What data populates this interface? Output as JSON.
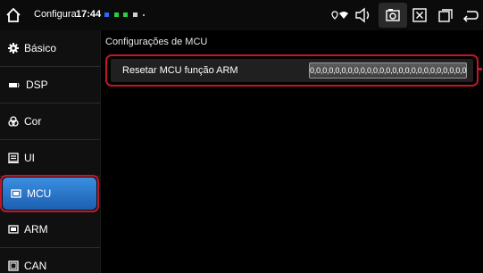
{
  "statusbar": {
    "app_title": "Configura",
    "time": "17:44",
    "notification_colors": [
      "#2a66ff",
      "#2ecc40",
      "#2ecc40",
      "#ffffff"
    ],
    "icons": [
      "home-icon",
      "location-icon",
      "wifi-icon",
      "volume-icon",
      "screenshot-icon",
      "close-window-icon",
      "recent-apps-icon",
      "back-icon"
    ]
  },
  "sidebar": {
    "items": [
      {
        "label": "Básico",
        "icon": "gear-icon"
      },
      {
        "label": "DSP",
        "icon": "equalizer-icon"
      },
      {
        "label": "Cor",
        "icon": "palette-icon"
      },
      {
        "label": "UI",
        "icon": "ui-icon"
      },
      {
        "label": "MCU",
        "icon": "chip-icon",
        "active": true
      },
      {
        "label": "ARM",
        "icon": "arm-chip-icon"
      },
      {
        "label": "CAN",
        "icon": "can-bus-icon"
      }
    ]
  },
  "main": {
    "section_title": "Configurações de MCU",
    "rows": [
      {
        "label": "Resetar MCU função ARM",
        "button_value": "0,0,0,0,0,0,0,0,0,0,0,0,0,0,0,0,0,0,0,0,0,0,0,0,0"
      }
    ]
  },
  "colors": {
    "accent": "#2f7fd6",
    "highlight": "#c0182a",
    "background": "#000000"
  }
}
